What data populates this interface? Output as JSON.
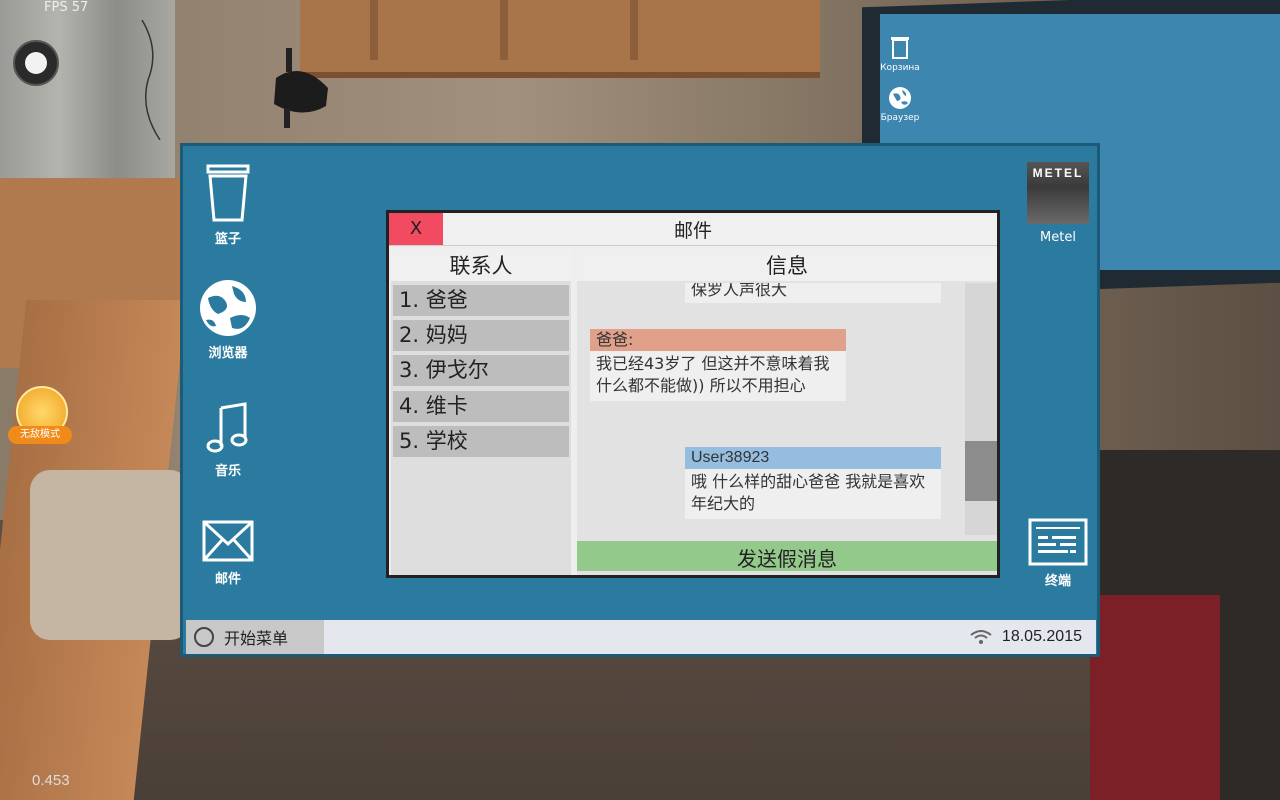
{
  "hud": {
    "fps": "FPS 57",
    "corner_value": "0.453",
    "badge_label": "无敌模式"
  },
  "desktop": {
    "icons_left": [
      {
        "label": "篮子",
        "icon": "trash-icon"
      },
      {
        "label": "浏览器",
        "icon": "globe-icon"
      },
      {
        "label": "音乐",
        "icon": "music-note-icon"
      },
      {
        "label": "邮件",
        "icon": "envelope-icon"
      }
    ],
    "icons_right": [
      {
        "label": "Metel",
        "icon": "metel-game-icon",
        "image_text": "METEL"
      },
      {
        "label": "终端",
        "icon": "terminal-icon"
      }
    ]
  },
  "background_monitor": {
    "icons": [
      "Корзина",
      "Браузер"
    ]
  },
  "taskbar": {
    "start_label": "开始菜单",
    "date": "18.05.2015"
  },
  "mail_window": {
    "title": "邮件",
    "close_label": "X",
    "contacts_header": "联系人",
    "contacts": [
      "1. 爸爸",
      "2. 妈妈",
      "3. 伊戈尔",
      "4. 维卡",
      "5. 学校"
    ],
    "messages_header": "信息",
    "messages": [
      {
        "sender": "",
        "text": "保罗人声很大",
        "partial": true
      },
      {
        "sender": "爸爸:",
        "text": "我已经43岁了 但这并不意味着我什么都不能做)) 所以不用担心",
        "header_color": "#e0a08a"
      },
      {
        "sender": "User38923",
        "text": "哦 什么样的甜心爸爸 我就是喜欢年纪大的",
        "header_color": "#94bde0"
      }
    ],
    "send_button": "发送假消息"
  }
}
